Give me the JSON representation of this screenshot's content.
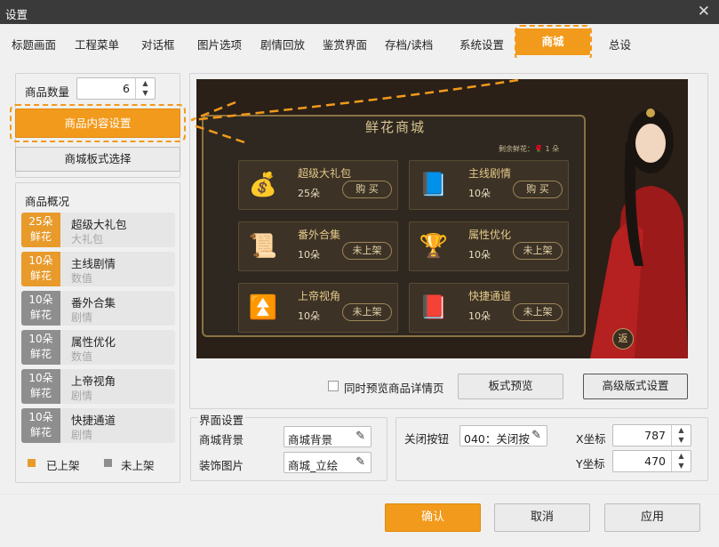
{
  "window": {
    "title": "设置",
    "close_glyph": "✕"
  },
  "tabs": [
    "标题画面",
    "工程菜单",
    "对话框",
    "图片选项",
    "剧情回放",
    "鉴赏界面",
    "存档/读档",
    "系统设置",
    "商城",
    "总设"
  ],
  "active_tab": "商城",
  "left": {
    "count_label": "商品数量",
    "count_value": "6",
    "content_settings_button": "商品内容设置",
    "layout_button": "商城板式选择",
    "overview_title": "商品概况",
    "items": [
      {
        "price": "25朵",
        "unit": "鲜花",
        "name": "超级大礼包",
        "category": "大礼包",
        "on_shelf": true
      },
      {
        "price": "10朵",
        "unit": "鲜花",
        "name": "主线剧情",
        "category": "数值",
        "on_shelf": true
      },
      {
        "price": "10朵",
        "unit": "鲜花",
        "name": "番外合集",
        "category": "剧情",
        "on_shelf": false
      },
      {
        "price": "10朵",
        "unit": "鲜花",
        "name": "属性优化",
        "category": "数值",
        "on_shelf": false
      },
      {
        "price": "10朵",
        "unit": "鲜花",
        "name": "上帝视角",
        "category": "剧情",
        "on_shelf": false
      },
      {
        "price": "10朵",
        "unit": "鲜花",
        "name": "快捷通道",
        "category": "剧情",
        "on_shelf": false
      }
    ],
    "legend_on": "已上架",
    "legend_off": "未上架"
  },
  "preview": {
    "shop_title": "鲜花商城",
    "remaining": "剩余鲜花：🌹 1 朵",
    "cards": [
      {
        "name": "超级大礼包",
        "price": "25朵",
        "button": "购 买",
        "icon": "gift-bag-icon",
        "glyph": "💰"
      },
      {
        "name": "主线剧情",
        "price": "10朵",
        "button": "购 买",
        "icon": "book-icon",
        "glyph": "📘"
      },
      {
        "name": "番外合集",
        "price": "10朵",
        "button": "未上架",
        "icon": "scroll-icon",
        "glyph": "📜"
      },
      {
        "name": "属性优化",
        "price": "10朵",
        "button": "未上架",
        "icon": "buddha-icon",
        "glyph": "🏆"
      },
      {
        "name": "上帝视角",
        "price": "10朵",
        "button": "未上架",
        "icon": "arrow-up-icon",
        "glyph": "⏫"
      },
      {
        "name": "快捷通道",
        "price": "10朵",
        "button": "未上架",
        "icon": "red-book-icon",
        "glyph": "📕"
      }
    ],
    "return_glyph": "返"
  },
  "preview_options": {
    "sync_label": "同时预览商品详情页",
    "layout_preview_button": "板式预览",
    "advanced_button": "高级版式设置"
  },
  "interface": {
    "section_title": "界面设置",
    "bg_label": "商城背景",
    "bg_value": "商城背景",
    "deco_label": "装饰图片",
    "deco_value": "商城_立绘"
  },
  "close_settings": {
    "label": "关闭按钮",
    "value": "040：关闭按",
    "x_label": "X坐标",
    "x_value": "787",
    "y_label": "Y坐标",
    "y_value": "470"
  },
  "footer": {
    "ok": "确认",
    "cancel": "取消",
    "apply": "应用"
  },
  "colors": {
    "accent": "#f29a1b",
    "on_shelf": "#e89a2b",
    "off_shelf": "#8e8e8e"
  }
}
